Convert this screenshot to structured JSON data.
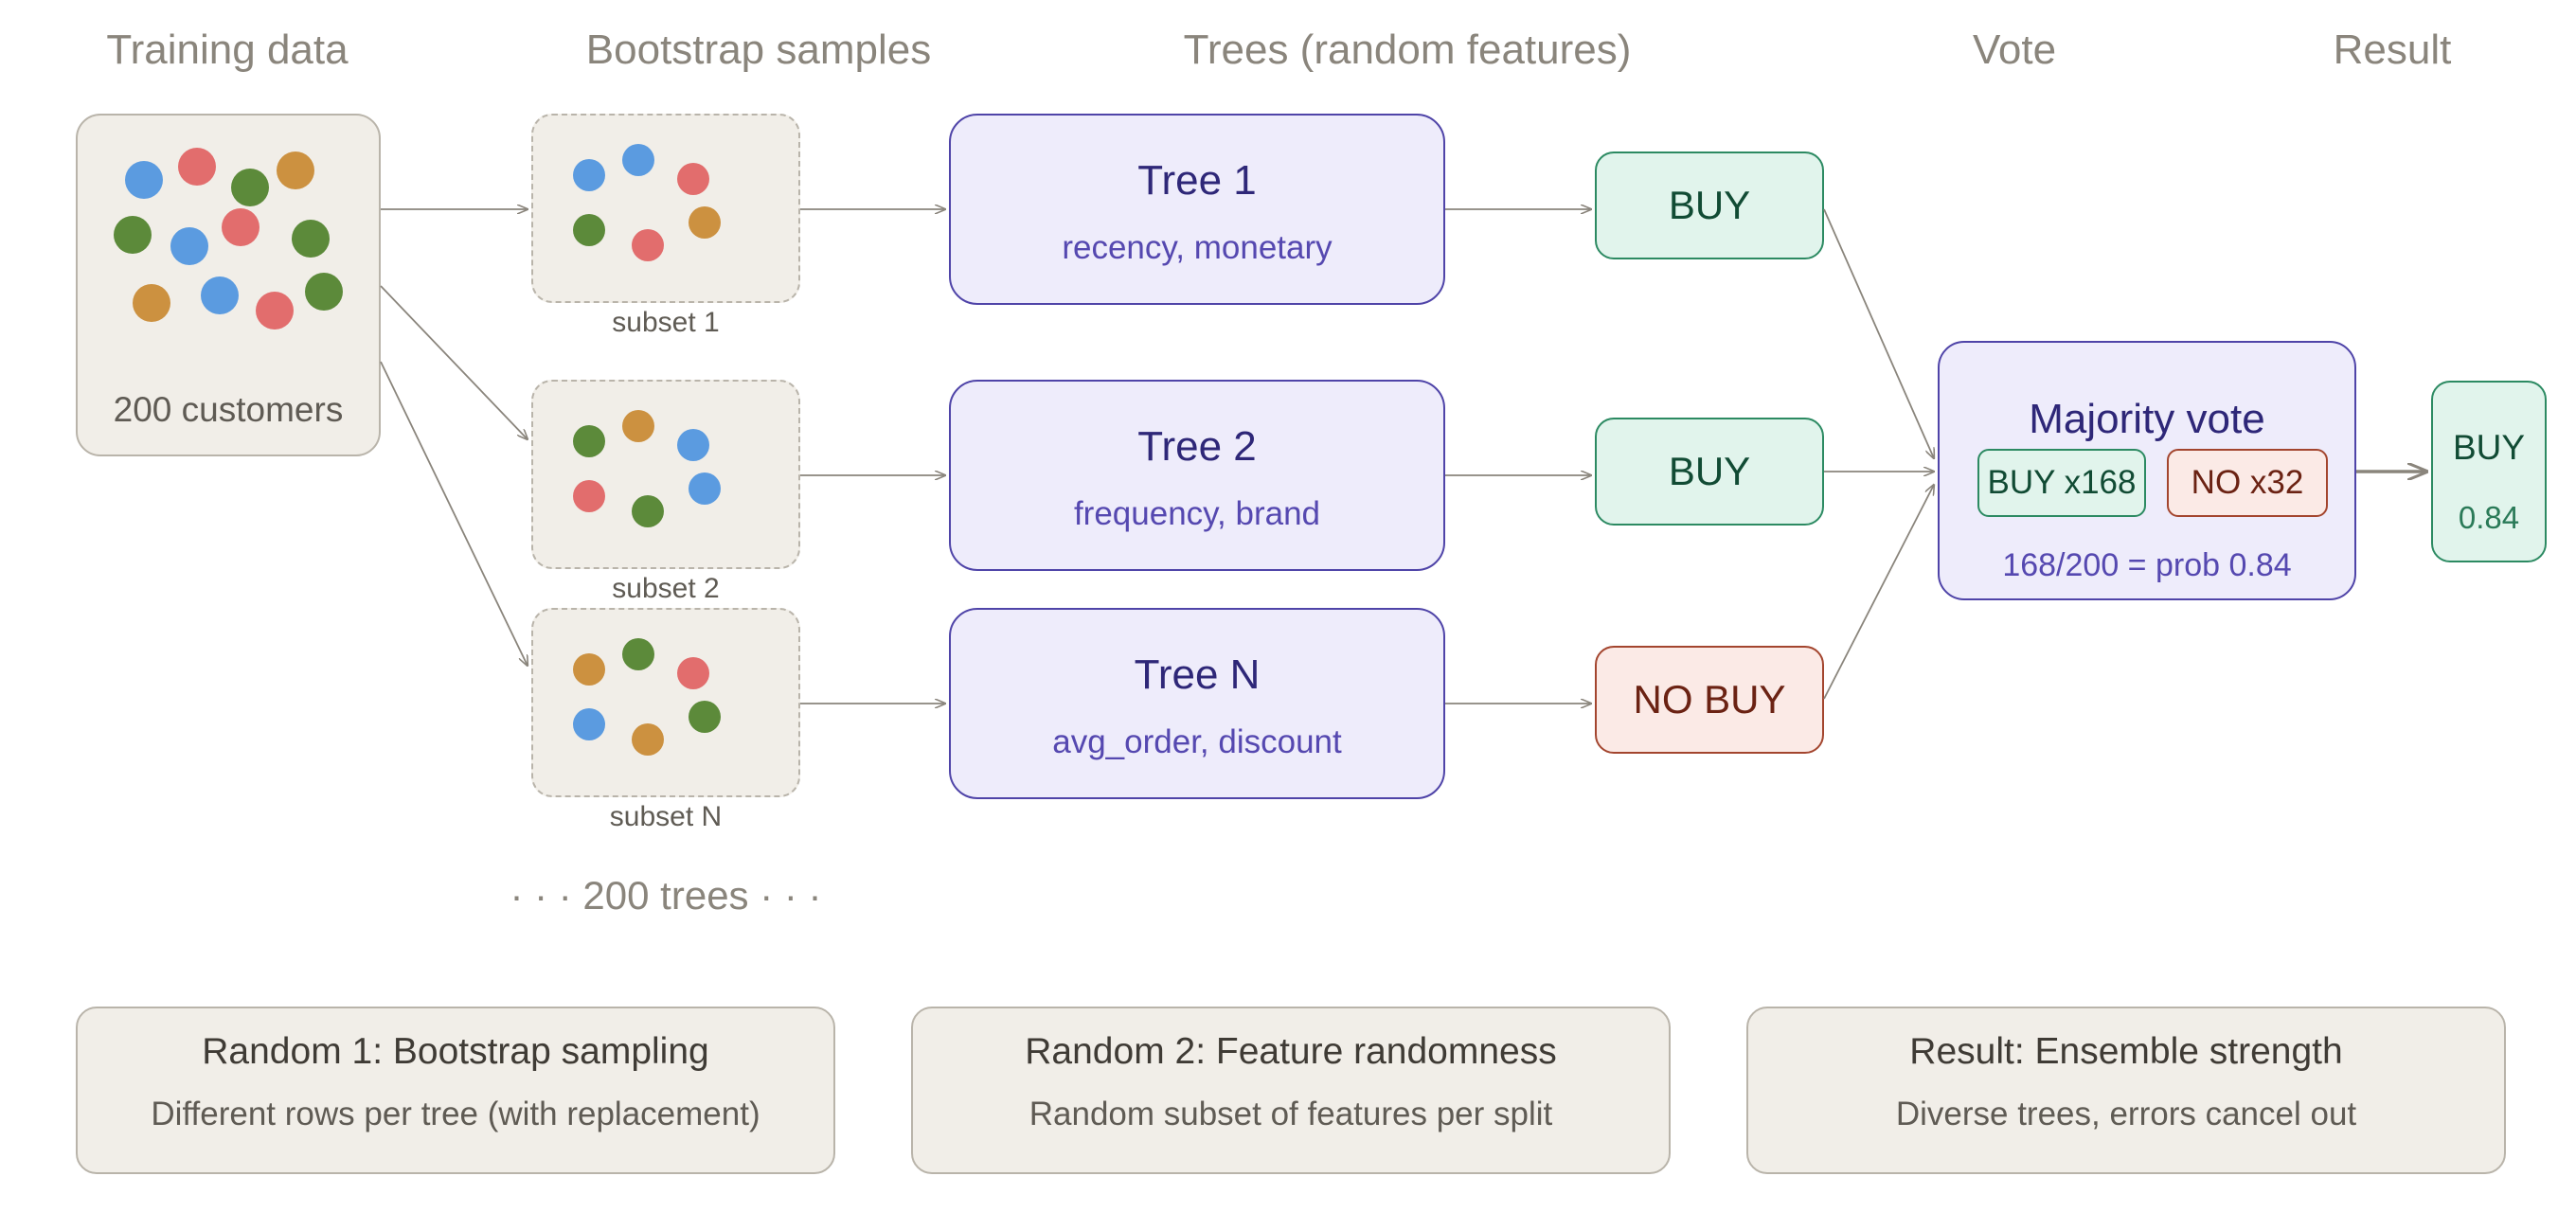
{
  "headers": {
    "training": "Training data",
    "bootstrap": "Bootstrap samples",
    "trees": "Trees (random features)",
    "vote": "Vote",
    "result": "Result"
  },
  "training": {
    "label": "200 customers"
  },
  "subsets": [
    {
      "label": "subset 1"
    },
    {
      "label": "subset 2"
    },
    {
      "label": "subset N"
    }
  ],
  "trees": [
    {
      "title": "Tree 1",
      "features": "recency, monetary"
    },
    {
      "title": "Tree 2",
      "features": "frequency, brand"
    },
    {
      "title": "Tree N",
      "features": "avg_order, discount"
    }
  ],
  "predictions": [
    "BUY",
    "BUY",
    "NO BUY"
  ],
  "vote": {
    "title": "Majority vote",
    "buy_chip": "BUY x168",
    "no_chip": "NO x32",
    "calc": "168/200 = prob 0.84"
  },
  "result": {
    "label": "BUY",
    "value": "0.84"
  },
  "trees_count": "· · · 200 trees · · ·",
  "notes": [
    {
      "title": "Random 1: Bootstrap sampling",
      "text": "Different rows per tree (with replacement)"
    },
    {
      "title": "Random 2: Feature randomness",
      "text": "Random subset of features per split"
    },
    {
      "title": "Result: Ensemble strength",
      "text": "Diverse trees, errors cancel out"
    }
  ],
  "colors": {
    "dot_blue": "#5b9be0",
    "dot_red": "#e26d6d",
    "dot_green": "#5c8a3a",
    "dot_orange": "#cc9140",
    "tree_border": "#4f44a8",
    "buy_border": "#2c8a62",
    "no_border": "#a3452e"
  }
}
